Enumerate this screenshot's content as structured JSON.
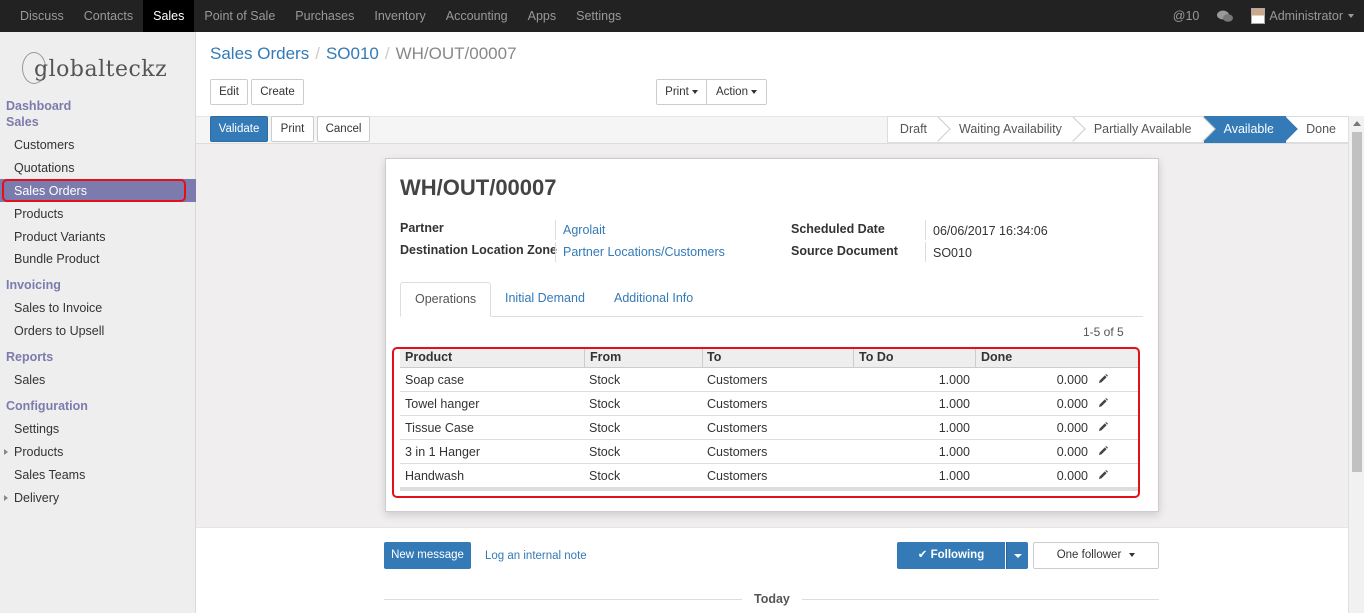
{
  "topbar": {
    "menu": [
      "Discuss",
      "Contacts",
      "Sales",
      "Point of Sale",
      "Purchases",
      "Inventory",
      "Accounting",
      "Apps",
      "Settings"
    ],
    "active_menu": "Sales",
    "mentions": "@10",
    "chat_icon": "chat-bubbles-icon",
    "user": "Administrator"
  },
  "sidebar": {
    "logo": "globalteckz",
    "dashboard": "Dashboard",
    "sales_head": "Sales",
    "sales_items": [
      "Customers",
      "Quotations",
      "Sales Orders",
      "Products",
      "Product Variants",
      "Bundle Product"
    ],
    "invoicing_head": "Invoicing",
    "invoicing_items": [
      "Sales to Invoice",
      "Orders to Upsell"
    ],
    "reports_head": "Reports",
    "reports_items": [
      "Sales"
    ],
    "config_head": "Configuration",
    "config_items": [
      "Settings",
      "Products",
      "Sales Teams",
      "Delivery"
    ]
  },
  "breadcrumb": {
    "root": "Sales Orders",
    "middle": "SO010",
    "current": "WH/OUT/00007"
  },
  "toolbar": {
    "edit": "Edit",
    "create": "Create",
    "print": "Print",
    "action": "Action"
  },
  "statusbar": {
    "validate": "Validate",
    "print": "Print",
    "cancel": "Cancel",
    "stages": [
      "Draft",
      "Waiting Availability",
      "Partially Available",
      "Available",
      "Done"
    ],
    "active_stage": "Available"
  },
  "form": {
    "title": "WH/OUT/00007",
    "partner_label": "Partner",
    "partner_value": "Agrolait",
    "dest_label": "Destination Location Zone",
    "dest_value": "Partner Locations/Customers",
    "scheduled_label": "Scheduled Date",
    "scheduled_value": "06/06/2017 16:34:06",
    "source_label": "Source Document",
    "source_value": "SO010"
  },
  "tabs": [
    "Operations",
    "Initial Demand",
    "Additional Info"
  ],
  "pager": "1-5 of 5",
  "table": {
    "headers": [
      "Product",
      "From",
      "To",
      "To Do",
      "Done"
    ],
    "rows": [
      [
        "Soap case",
        "Stock",
        "Customers",
        "1.000",
        "0.000"
      ],
      [
        "Towel hanger",
        "Stock",
        "Customers",
        "1.000",
        "0.000"
      ],
      [
        "Tissue Case",
        "Stock",
        "Customers",
        "1.000",
        "0.000"
      ],
      [
        "3 in 1 Hanger",
        "Stock",
        "Customers",
        "1.000",
        "0.000"
      ],
      [
        "Handwash",
        "Stock",
        "Customers",
        "1.000",
        "0.000"
      ]
    ]
  },
  "chatter": {
    "new_message": "New message",
    "log_note": "Log an internal note",
    "following": "✔ Following",
    "followers": "One follower",
    "today": "Today"
  },
  "colors": {
    "primary": "#337ab7",
    "sidebar_active": "#7c7bad",
    "highlight": "#e3101a",
    "topbar": "#222222"
  }
}
